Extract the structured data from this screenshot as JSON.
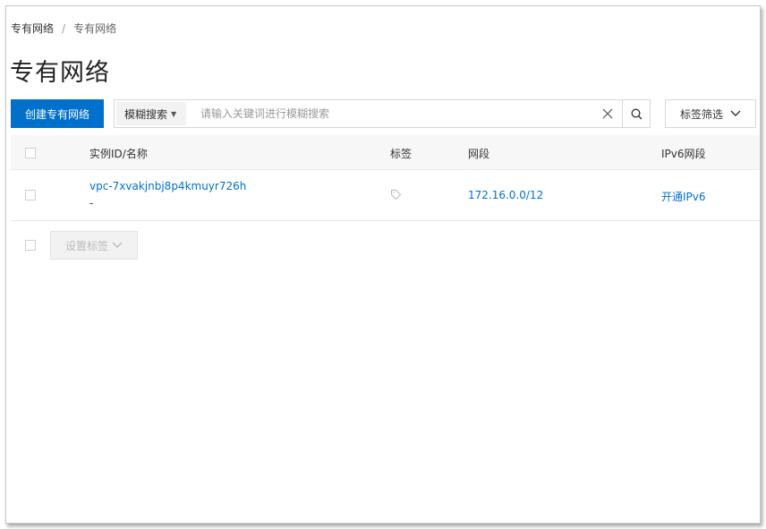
{
  "breadcrumb": {
    "root": "专有网络",
    "separator": "/",
    "current": "专有网络"
  },
  "page_title": "专有网络",
  "toolbar": {
    "create_label": "创建专有网络",
    "search_type": "模糊搜索",
    "search_placeholder": "请输入关键词进行模糊搜索",
    "tag_filter_label": "标签筛选"
  },
  "table": {
    "columns": {
      "instance": "实例ID/名称",
      "tags": "标签",
      "cidr": "网段",
      "ipv6": "IPv6网段"
    },
    "rows": [
      {
        "id": "vpc-7xvakjnbj8p4kmuyr726h",
        "name": "-",
        "cidr": "172.16.0.0/12",
        "ipv6_action": "开通IPv6"
      }
    ]
  },
  "footer": {
    "set_tags_label": "设置标签"
  },
  "colors": {
    "primary": "#0070cc",
    "header_bg": "#f7f7f7"
  },
  "icons": [
    "caret-down-icon",
    "clear-icon",
    "search-icon",
    "chevron-down-icon",
    "tag-icon"
  ]
}
